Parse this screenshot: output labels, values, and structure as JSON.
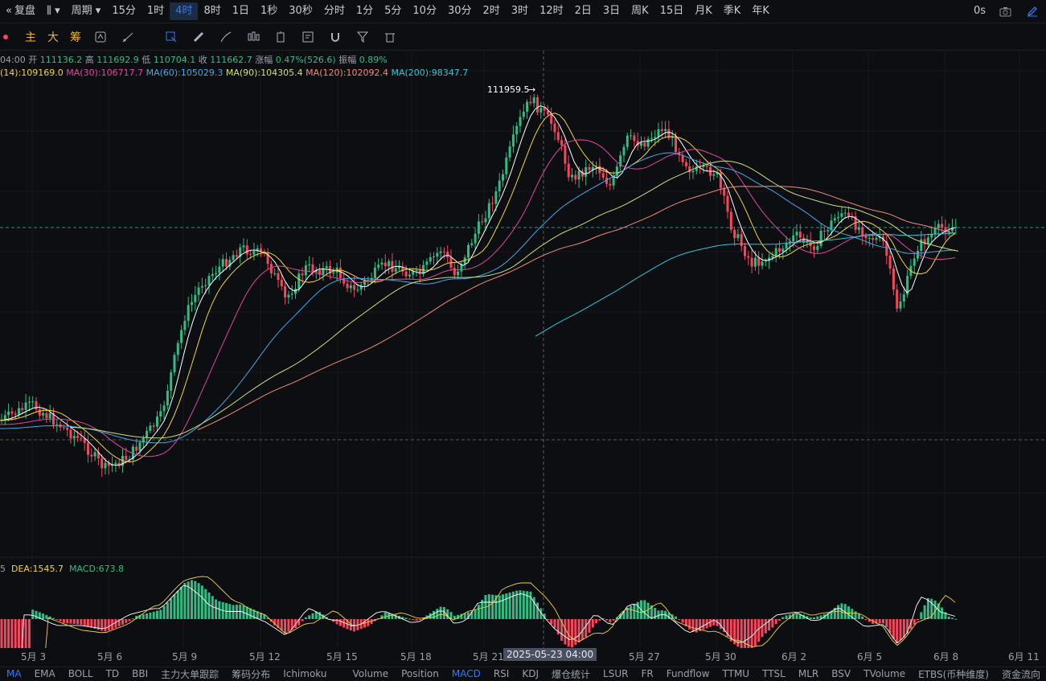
{
  "toolbar": {
    "replay": "复盘",
    "period": "周期",
    "timeframes": [
      "15分",
      "1时",
      "4时",
      "8时",
      "1日",
      "1秒",
      "30秒",
      "分时",
      "1分",
      "5分",
      "10分",
      "30分",
      "2时",
      "3时",
      "12时",
      "2日",
      "3日",
      "周K",
      "15日",
      "月K",
      "季K",
      "年K"
    ],
    "active_timeframe": "4时",
    "countdown": "0s"
  },
  "drawtools": {
    "zhu": "主",
    "da": "大",
    "chou": "筹"
  },
  "info": {
    "time_prefix": "04:00",
    "open_label": "开",
    "open": "111136.2",
    "high_label": "高",
    "high": "111692.9",
    "low_label": "低",
    "low": "110704.1",
    "close_label": "收",
    "close": "111662.7",
    "change_label": "涨幅",
    "change": "0.47%(526.6)",
    "amp_label": "振幅",
    "amp": "0.89%"
  },
  "ma": {
    "ma14": "(14):109169.0",
    "ma30": "MA(30):106717.7",
    "ma60": "MA(60):105029.3",
    "ma90": "MA(90):104305.4",
    "ma120": "MA(120):102092.4",
    "ma200": "MA(200):98347.7"
  },
  "colors": {
    "up": "#2ebd85",
    "down": "#f6465d",
    "ma14": "#f0d53a",
    "ma30": "#e0479e",
    "ma60": "#3fa9e8",
    "ma90": "#c9e07a",
    "ma120": "#f08a7a",
    "ma200": "#2ec6d6"
  },
  "high_marker": "111959.5",
  "macd": {
    "prefix": "5",
    "dea": "DEA:1545.7",
    "macd": "MACD:673.8"
  },
  "crosshair_label": "2025-05-23 04:00",
  "xaxis": [
    "5月 3",
    "5月 6",
    "5月 9",
    "5月 12",
    "5月 15",
    "5月 18",
    "5月 21",
    "5月 27",
    "5月 30",
    "6月 2",
    "6月 5",
    "6月 8",
    "6月 11"
  ],
  "indicators": [
    "MA",
    "EMA",
    "BOLL",
    "TD",
    "BBI",
    "主力大单跟踪",
    "筹码分布",
    "Ichimoku",
    "Volume",
    "Position",
    "MACD",
    "RSI",
    "KDJ",
    "爆仓统计",
    "LSUR",
    "FR",
    "Fundflow",
    "TTMU",
    "TTSL",
    "MLR",
    "BSV",
    "TVolume",
    "ETBS(币种维度)",
    "资金流向"
  ],
  "active_indicator_main": "MA",
  "active_indicator_sub": "MACD",
  "chart_data": {
    "type": "candlestick",
    "interval": "4时",
    "x_range": [
      "5月 3",
      "6月 8"
    ],
    "highest": 111959.5,
    "last_close": 111662.7
  }
}
